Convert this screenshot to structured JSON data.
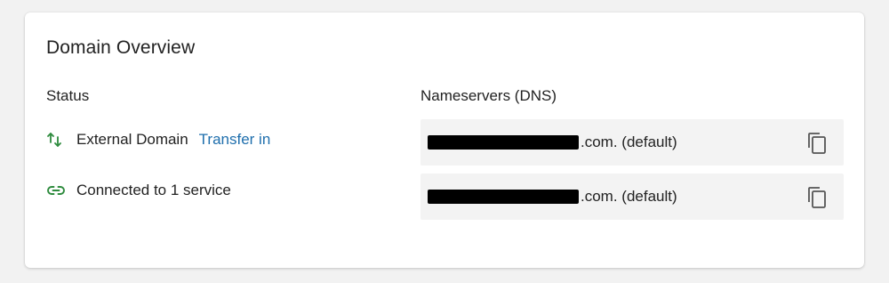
{
  "card": {
    "title": "Domain Overview"
  },
  "status": {
    "heading": "Status",
    "items": [
      {
        "label": "External Domain",
        "link": "Transfer in",
        "icon": "transfer-arrows-icon"
      },
      {
        "label": "Connected to 1 service",
        "icon": "link-icon"
      }
    ]
  },
  "nameservers": {
    "heading": "Nameservers (DNS)",
    "items": [
      {
        "suffix": ".com. (default)",
        "redacted": true
      },
      {
        "suffix": ".com. (default)",
        "redacted": true
      }
    ]
  },
  "colors": {
    "accent_link": "#1f6fad",
    "icon_green": "#2e8b3e",
    "nameserver_bg": "#f3f3f3"
  }
}
